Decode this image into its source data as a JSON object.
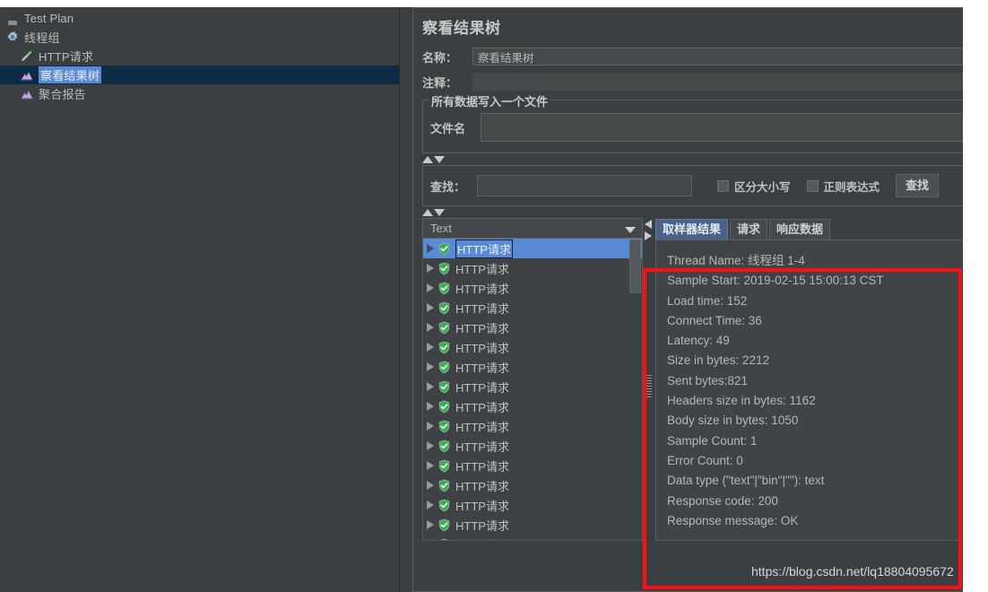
{
  "sidebar": {
    "items": [
      {
        "label": "Test Plan",
        "icon": "testplan-icon",
        "indent": 1,
        "selected": false
      },
      {
        "label": "线程组",
        "icon": "gear-icon",
        "indent": 1,
        "selected": false
      },
      {
        "label": "HTTP请求",
        "icon": "pipette-icon",
        "indent": 2,
        "selected": false
      },
      {
        "label": "察看结果树",
        "icon": "chart-icon",
        "indent": 2,
        "selected": true
      },
      {
        "label": "聚合报告",
        "icon": "chart-icon",
        "indent": 2,
        "selected": false
      }
    ]
  },
  "panel": {
    "title": "察看结果树",
    "name_label": "名称：",
    "name_value": "察看结果树",
    "comment_label": "注释：",
    "comment_value": "",
    "file_group_legend": "所有数据写入一个文件",
    "filename_label": "文件名",
    "filename_value": "",
    "search_label": "查找：",
    "search_value": "",
    "case_sensitive_label": "区分大小写",
    "regex_label": "正则表达式",
    "find_button_label": "查找"
  },
  "results": {
    "render_selector_value": "Text",
    "rows": [
      {
        "label": "HTTP请求",
        "status": "success",
        "selected": true
      },
      {
        "label": "HTTP请求",
        "status": "success",
        "selected": false
      },
      {
        "label": "HTTP请求",
        "status": "success",
        "selected": false
      },
      {
        "label": "HTTP请求",
        "status": "success",
        "selected": false
      },
      {
        "label": "HTTP请求",
        "status": "success",
        "selected": false
      },
      {
        "label": "HTTP请求",
        "status": "success",
        "selected": false
      },
      {
        "label": "HTTP请求",
        "status": "success",
        "selected": false
      },
      {
        "label": "HTTP请求",
        "status": "success",
        "selected": false
      },
      {
        "label": "HTTP请求",
        "status": "success",
        "selected": false
      },
      {
        "label": "HTTP请求",
        "status": "success",
        "selected": false
      },
      {
        "label": "HTTP请求",
        "status": "success",
        "selected": false
      },
      {
        "label": "HTTP请求",
        "status": "success",
        "selected": false
      },
      {
        "label": "HTTP请求",
        "status": "success",
        "selected": false
      },
      {
        "label": "HTTP请求",
        "status": "success",
        "selected": false
      },
      {
        "label": "HTTP请求",
        "status": "success",
        "selected": false
      },
      {
        "label": "HTTP请求",
        "status": "success",
        "selected": false
      }
    ]
  },
  "tabs": [
    {
      "label": "取样器结果",
      "active": true
    },
    {
      "label": "请求",
      "active": false
    },
    {
      "label": "响应数据",
      "active": false
    }
  ],
  "sampler_result": {
    "lines": [
      "Thread Name: 线程组 1-4",
      "Sample Start: 2019-02-15 15:00:13 CST",
      "Load time: 152",
      "Connect Time: 36",
      "Latency: 49",
      "Size in bytes: 2212",
      "Sent bytes:821",
      "Headers size in bytes: 1162",
      "Body size in bytes: 1050",
      "Sample Count: 1",
      "Error Count: 0",
      "Data type (\"text\"|\"bin\"|\"\"): text",
      "Response code: 200",
      "Response message: OK"
    ]
  },
  "annotation": {
    "highlight_color": "#fb0f0f"
  },
  "watermark": {
    "text": "https://blog.csdn.net/lq18804095672"
  }
}
